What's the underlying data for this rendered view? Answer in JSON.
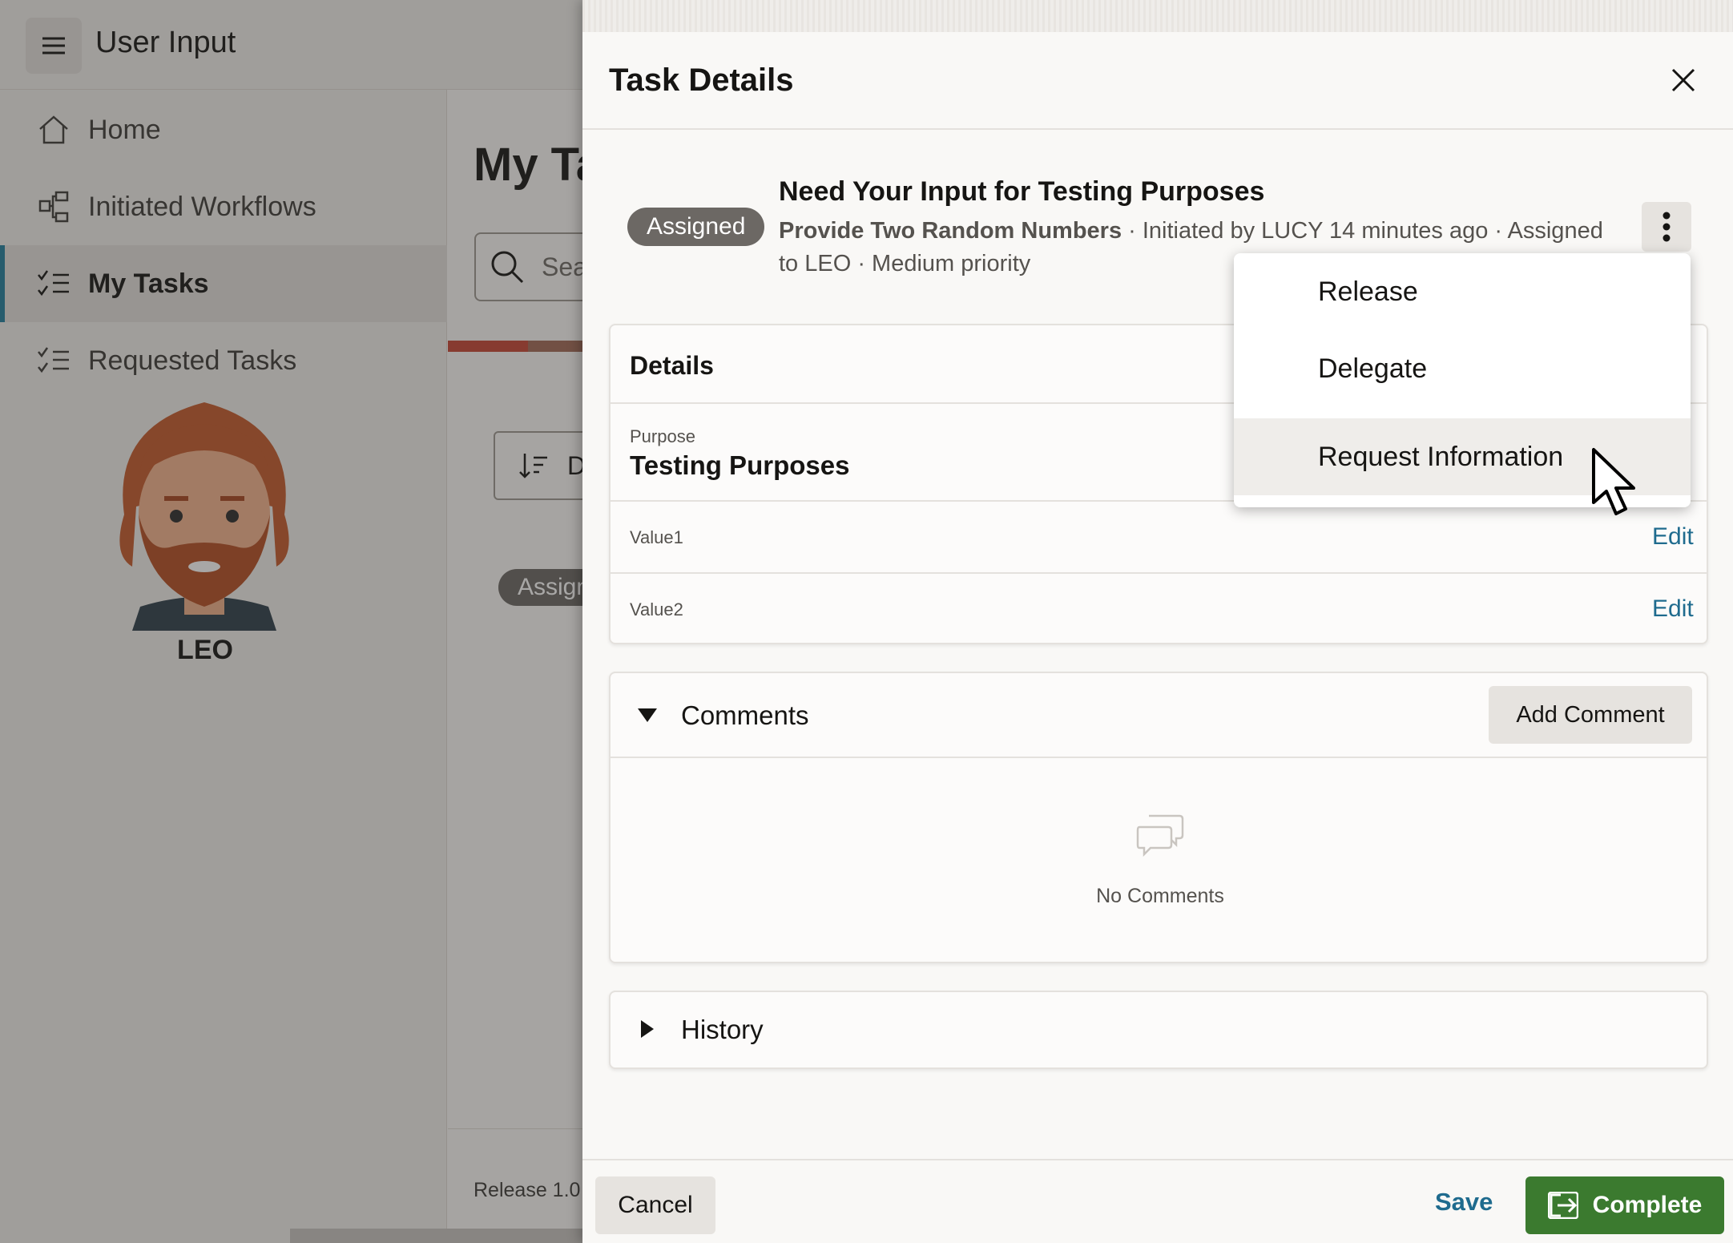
{
  "app": {
    "title": "User Input",
    "nav": [
      {
        "label": "Home",
        "icon": "home-icon",
        "active": false
      },
      {
        "label": "Initiated Workflows",
        "icon": "workflow-icon",
        "active": false
      },
      {
        "label": "My Tasks",
        "icon": "checklist-icon",
        "active": true
      },
      {
        "label": "Requested Tasks",
        "icon": "checklist-icon",
        "active": false
      }
    ],
    "user_name": "LEO",
    "main_title": "My Ta",
    "search_placeholder": "Sea",
    "sort_label": "D",
    "badge": "Assign",
    "release": "Release 1.0"
  },
  "drawer": {
    "title": "Task Details",
    "status": "Assigned",
    "task_title": "Need Your Input for Testing Purposes",
    "task_subject": "Provide Two Random Numbers",
    "task_meta": " · Initiated by LUCY 14 minutes ago · Assigned to LEO · Medium priority",
    "details": {
      "heading": "Details",
      "purpose_label": "Purpose",
      "purpose_value": "Testing Purposes",
      "fields": [
        {
          "label": "Value1",
          "action": "Edit"
        },
        {
          "label": "Value2",
          "action": "Edit"
        }
      ]
    },
    "comments": {
      "heading": "Comments",
      "add_label": "Add Comment",
      "empty_text": "No Comments"
    },
    "history": {
      "heading": "History"
    },
    "footer": {
      "cancel": "Cancel",
      "save": "Save",
      "complete": "Complete"
    }
  },
  "menu": {
    "items": [
      {
        "label": "Release",
        "hovered": false
      },
      {
        "label": "Delegate",
        "hovered": false
      },
      {
        "label": "Request Information",
        "hovered": true
      }
    ]
  },
  "colors": {
    "accent": "#227e9e",
    "link": "#1f6b8e",
    "complete": "#3b7a2f",
    "badge": "#6c6864"
  }
}
